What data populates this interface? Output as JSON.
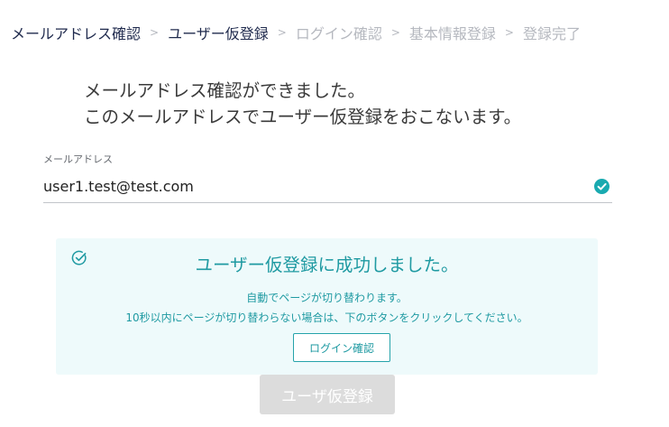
{
  "breadcrumb": {
    "steps": [
      {
        "label": "メールアドレス確認",
        "status": "done"
      },
      {
        "label": "ユーザー仮登録",
        "status": "current"
      },
      {
        "label": "ログイン確認",
        "status": "pending"
      },
      {
        "label": "基本情報登録",
        "status": "pending"
      },
      {
        "label": "登録完了",
        "status": "pending"
      }
    ],
    "separator": ">"
  },
  "lead": {
    "line1": "メールアドレス確認ができました。",
    "line2": "このメールアドレスでユーザー仮登録をおこないます。"
  },
  "email_field": {
    "label": "メールアドレス",
    "value": "user1.test@test.com",
    "status_icon": "check-circle-icon",
    "status": "valid"
  },
  "success_panel": {
    "icon": "check-circle-outline-icon",
    "title": "ユーザー仮登録に成功しました。",
    "message_line1": "自動でページが切り替わります。",
    "message_line2": "10秒以内にページが切り替わらない場合は、下のボタンをクリックしてください。",
    "login_button_label": "ログイン確認"
  },
  "register_button": {
    "label": "ユーザ仮登録",
    "disabled": true
  },
  "colors": {
    "accent": "#1f9aa2",
    "check_fill": "#19aab0",
    "panel_bg": "#eefafb",
    "breadcrumb_done": "#1f2a4d",
    "breadcrumb_pending": "#b5b8bf",
    "disabled_button": "#dcdcdc"
  }
}
